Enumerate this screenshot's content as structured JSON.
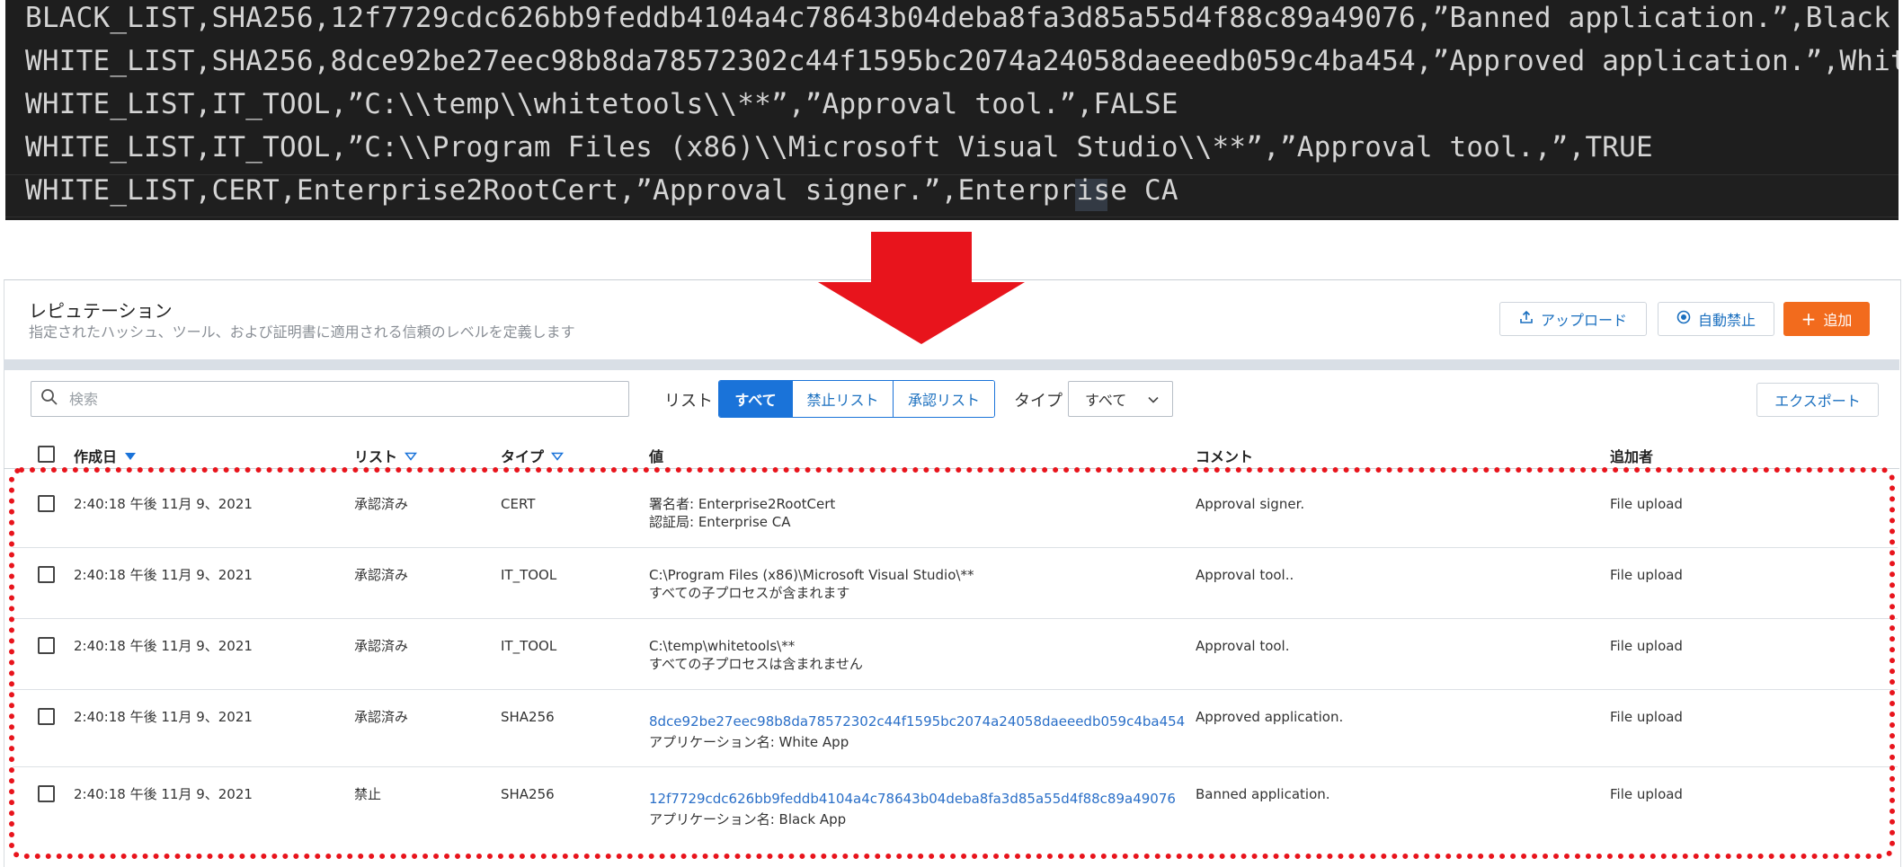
{
  "csv_lines": [
    "BLACK_LIST,SHA256,12f7729cdc626bb9feddb4104a4c78643b04deba8fa3d85a55d4f88c89a49076,”Banned application.”,Black App",
    "WHITE_LIST,SHA256,8dce92be27eec98b8da78572302c44f1595bc2074a24058daeeedb059c4ba454,”Approved application.”,White App",
    "WHITE_LIST,IT_TOOL,”C:\\\\temp\\\\whitetools\\\\**”,”Approval tool.”,FALSE",
    "WHITE_LIST,IT_TOOL,”C:\\\\Program Files (x86)\\\\Microsoft Visual Studio\\\\**”,”Approval tool.,”,TRUE",
    "WHITE_LIST,CERT,Enterprise2RootCert,”Approval signer.”,Enterprise CA"
  ],
  "colors": {
    "arrow": "#e8141c",
    "highlight_border": "#e8141c",
    "accent_blue": "#1a73d9",
    "primary_orange": "#f26b1d",
    "terminal_bg": "#1e1e1e"
  },
  "header": {
    "title": "レピュテーション",
    "subtitle": "指定されたハッシュ、ツール、および証明書に適用される信頼のレベルを定義します"
  },
  "actions": {
    "upload": {
      "label": "アップロード",
      "icon": "upload-icon"
    },
    "auto_ban": {
      "label": "自動禁止",
      "icon": "circle-dot-icon"
    },
    "add": {
      "label": "追加",
      "icon": "plus-icon"
    }
  },
  "toolbar": {
    "search_placeholder": "検索",
    "list_label": "リスト",
    "list_filters": [
      "すべて",
      "禁止リスト",
      "承認リスト"
    ],
    "list_selected": "すべて",
    "type_label": "タイプ",
    "type_value": "すべて",
    "export_label": "エクスポート"
  },
  "table": {
    "columns": [
      {
        "label": "作成日",
        "sort": "desc"
      },
      {
        "label": "リスト",
        "sort": "filter"
      },
      {
        "label": "タイプ",
        "sort": "filter"
      },
      {
        "label": "値"
      },
      {
        "label": "コメント"
      },
      {
        "label": "追加者"
      }
    ],
    "rows": [
      {
        "date": "2:40:18 午後 11月 9、2021",
        "list": "承認済み",
        "type": "CERT",
        "value_line1": "署名者: Enterprise2RootCert",
        "value_line1_link": false,
        "value_line2": "認証局: Enterprise CA",
        "comment": "Approval signer.",
        "added_by": "File upload"
      },
      {
        "date": "2:40:18 午後 11月 9、2021",
        "list": "承認済み",
        "type": "IT_TOOL",
        "value_line1": "C:\\Program Files (x86)\\Microsoft Visual Studio\\**",
        "value_line1_link": false,
        "value_line2": "すべての子プロセスが含まれます",
        "comment": "Approval tool..",
        "added_by": "File upload"
      },
      {
        "date": "2:40:18 午後 11月 9、2021",
        "list": "承認済み",
        "type": "IT_TOOL",
        "value_line1": "C:\\temp\\whitetools\\**",
        "value_line1_link": false,
        "value_line2": "すべての子プロセスは含まれません",
        "comment": "Approval tool.",
        "added_by": "File upload"
      },
      {
        "date": "2:40:18 午後 11月 9、2021",
        "list": "承認済み",
        "type": "SHA256",
        "value_line1": "8dce92be27eec98b8da78572302c44f1595bc2074a24058daeeedb059c4ba454",
        "value_line1_link": true,
        "value_line2": "アプリケーション名: White App",
        "comment": "Approved application.",
        "added_by": "File upload"
      },
      {
        "date": "2:40:18 午後 11月 9、2021",
        "list": "禁止",
        "type": "SHA256",
        "value_line1": "12f7729cdc626bb9feddb4104a4c78643b04deba8fa3d85a55d4f88c89a49076",
        "value_line1_link": true,
        "value_line2": "アプリケーション名: Black App",
        "comment": "Banned application.",
        "added_by": "File upload"
      }
    ]
  }
}
